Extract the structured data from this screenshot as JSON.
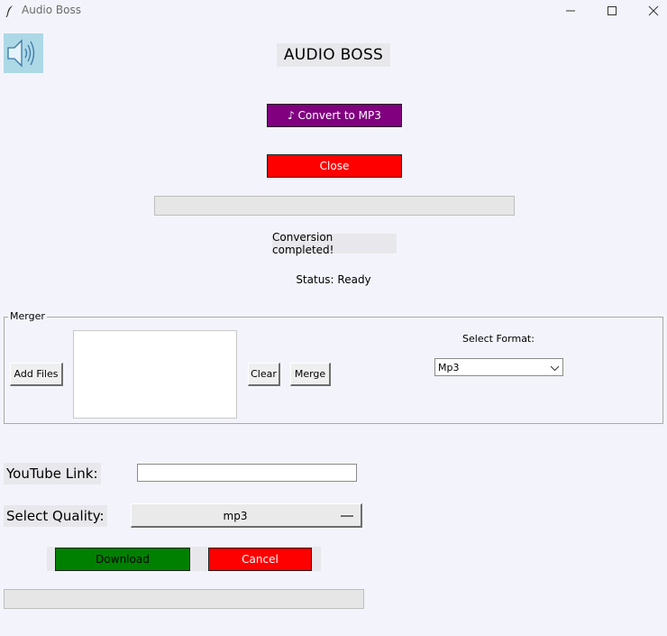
{
  "window": {
    "title": "Audio Boss",
    "icons": {
      "app": "feather-icon",
      "minimize": "minimize-icon",
      "maximize": "maximize-icon",
      "close": "close-icon"
    }
  },
  "header": {
    "logo_icon": "speaker-icon",
    "logo_bg": "#add8e6",
    "title": "AUDIO BOSS"
  },
  "converter": {
    "convert_label": "♪ Convert to MP3",
    "convert_color": "#800080",
    "close_label": "Close",
    "close_color": "#ff0000",
    "progress": 0,
    "message": "Conversion completed!",
    "status": "Status: Ready"
  },
  "merger": {
    "legend": "Merger",
    "add_files_label": "Add Files",
    "files": [],
    "clear_label": "Clear",
    "merge_label": "Merge",
    "format_label": "Select Format:",
    "format_value": "Mp3"
  },
  "youtube": {
    "link_label": "YouTube Link:",
    "link_value": "",
    "quality_label": "Select Quality:",
    "quality_value": "mp3",
    "download_label": "Download",
    "download_color": "#008000",
    "cancel_label": "Cancel",
    "cancel_color": "#ff0000",
    "progress": 0
  }
}
